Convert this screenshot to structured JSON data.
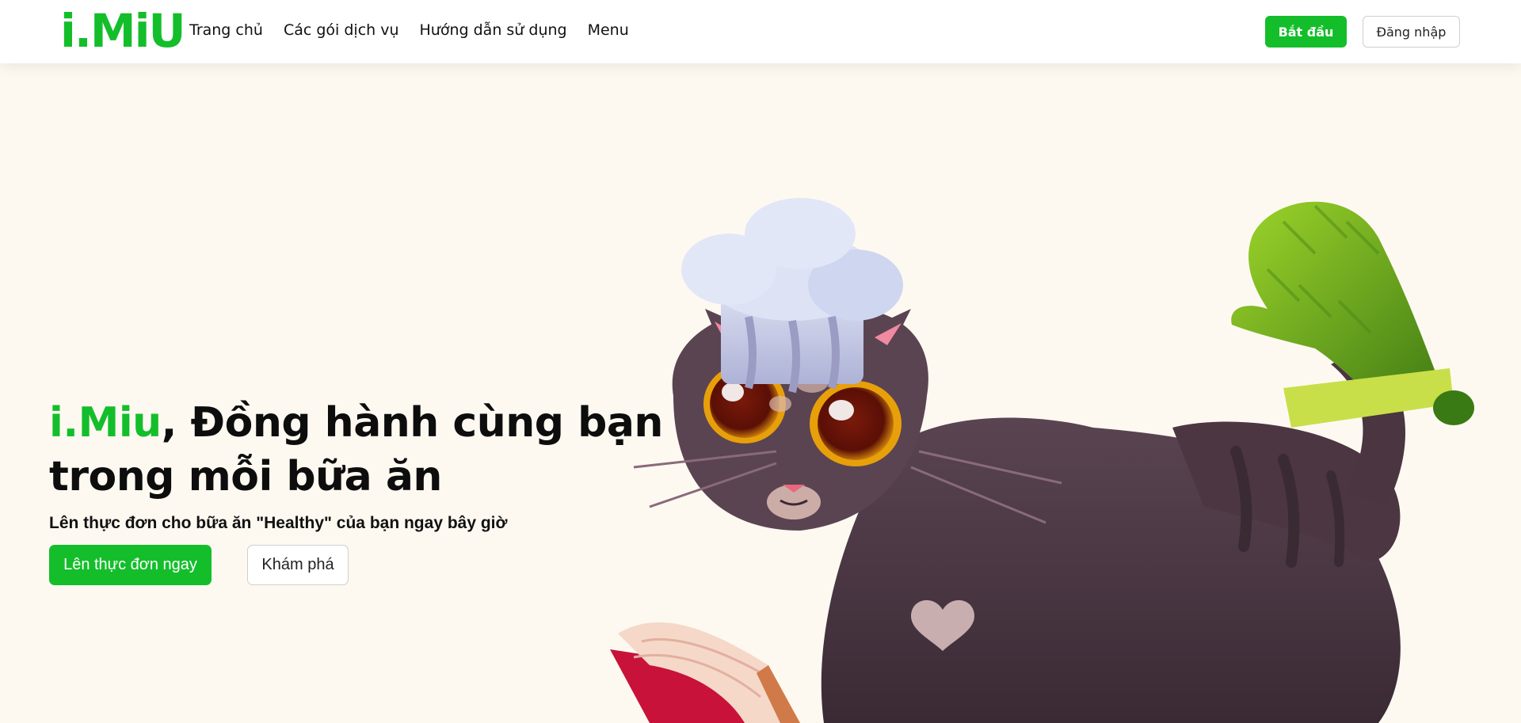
{
  "brand": {
    "logo_text": "i.MiU",
    "accent_color": "#14be2b",
    "background_color": "#fdf9f1"
  },
  "nav": {
    "links": [
      {
        "label": "Trang chủ"
      },
      {
        "label": "Các gói dịch vụ"
      },
      {
        "label": "Hướng dẫn sử dụng"
      },
      {
        "label": "Menu"
      }
    ],
    "start_label": "Bắt đầu",
    "login_label": "Đăng nhập"
  },
  "hero": {
    "title_brand": "i.Miu",
    "title_rest": ", Đồng hành cùng bạn trong mỗi bữa ăn",
    "subtitle": "Lên thực đơn cho bữa ăn \"Healthy\" của bạn ngay bây giờ",
    "primary_cta": "Lên thực đơn ngay",
    "secondary_cta": "Khám phá"
  },
  "illustration": {
    "icon": "cat-chef-icon"
  }
}
